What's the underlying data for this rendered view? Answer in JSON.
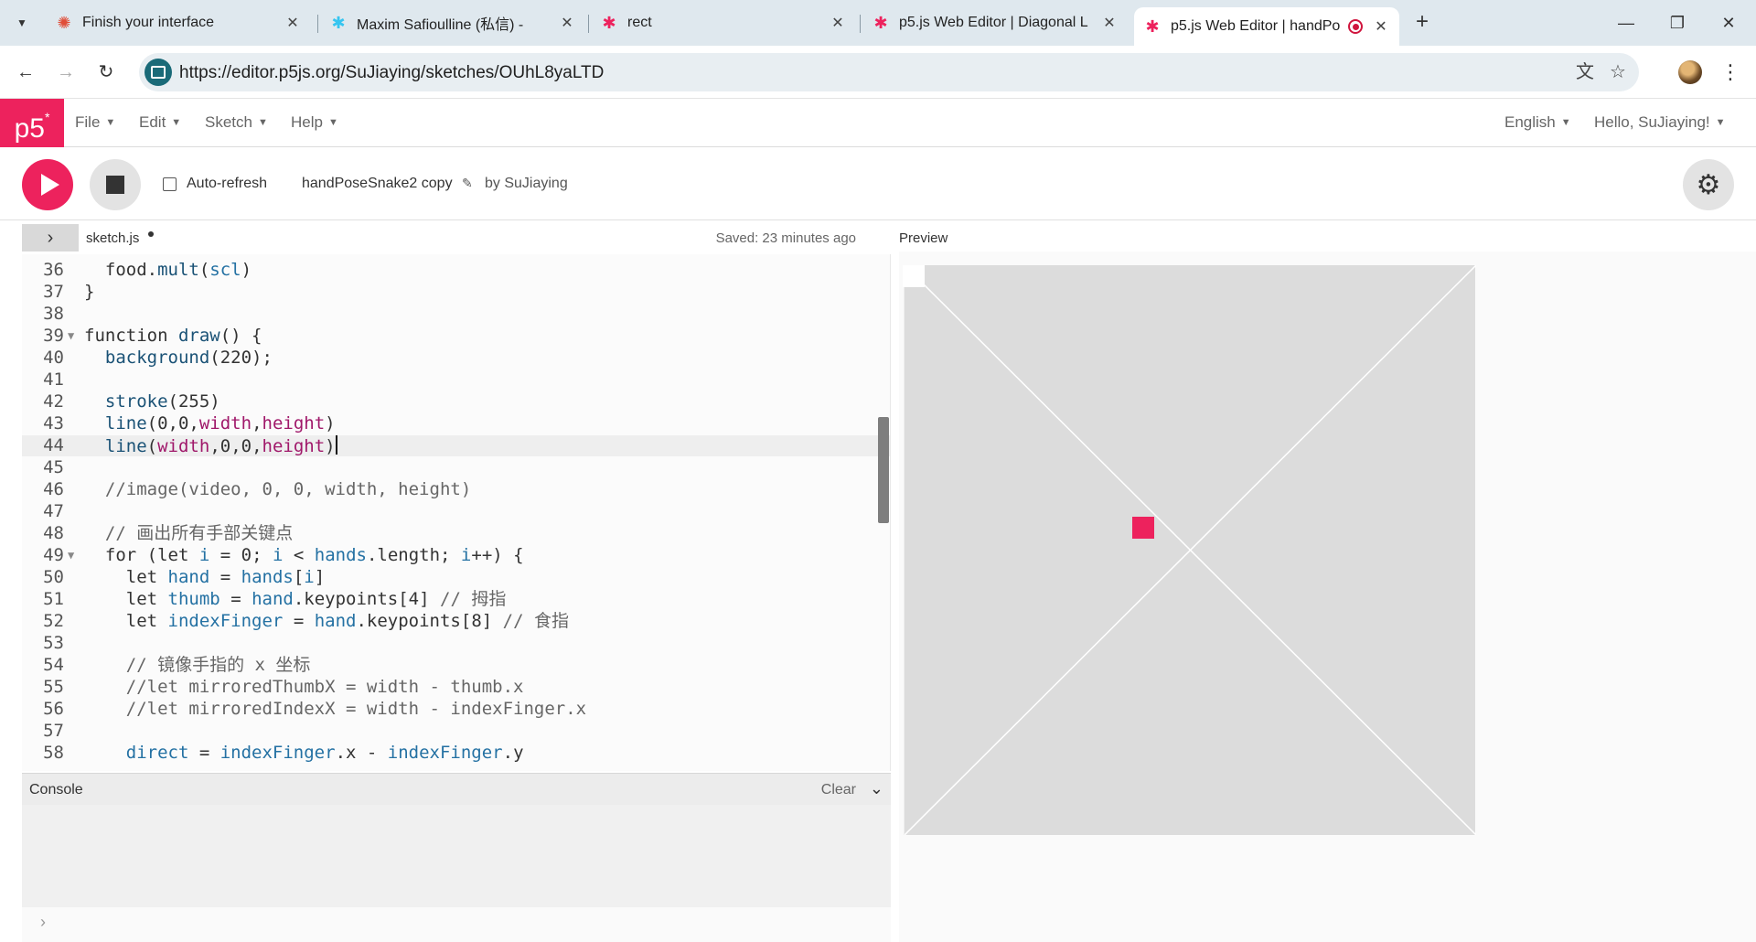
{
  "browser": {
    "tabs": [
      {
        "title": "Finish your interface"
      },
      {
        "title": "Maxim Safioulline (私信) - "
      },
      {
        "title": "rect"
      },
      {
        "title": "p5.js Web Editor | Diagonal L"
      },
      {
        "title": "p5.js Web Editor | handPo"
      }
    ],
    "url": "https://editor.p5js.org/SuJiaying/sketches/OUhL8yaLTD"
  },
  "app": {
    "logo": "p5",
    "menu": {
      "file": "File",
      "edit": "Edit",
      "sketch": "Sketch",
      "help": "Help"
    },
    "language": "English",
    "greeting": "Hello, SuJiaying!",
    "auto_refresh": "Auto-refresh",
    "sketch_name": "handPoseSnake2 copy",
    "byline": "by SuJiaying",
    "file_tab": "sketch.js",
    "saved_status": "Saved: 23 minutes ago",
    "preview_label": "Preview",
    "console": {
      "title": "Console",
      "clear": "Clear",
      "prompt": "›"
    }
  },
  "code": {
    "line_numbers": [
      "36",
      "37",
      "38",
      "39",
      "40",
      "41",
      "42",
      "43",
      "44",
      "45",
      "46",
      "47",
      "48",
      "49",
      "50",
      "51",
      "52",
      "53",
      "54",
      "55",
      "56",
      "57",
      "58"
    ],
    "lines": [
      "  food.mult(scl)",
      "}",
      "",
      "function draw() {",
      "  background(220);",
      "",
      "  stroke(255)",
      "  line(0,0,width,height)",
      "  line(width,0,0,height)",
      "",
      "  //image(video, 0, 0, width, height)",
      "",
      "  // 画出所有手部关键点",
      "  for (let i = 0; i < hands.length; i++) {",
      "    let hand = hands[i]",
      "    let thumb = hand.keypoints[4] // 拇指",
      "    let indexFinger = hand.keypoints[8] // 食指",
      "",
      "    // 镜像手指的 x 坐标",
      "    //let mirroredThumbX = width - thumb.x",
      "    //let mirroredIndexX = width - indexFinger.x",
      "",
      "    direct = indexFinger.x - indexFinger.y"
    ]
  },
  "colors": {
    "accent": "#ed225d",
    "canvas_bg": "#dcdcdc"
  }
}
